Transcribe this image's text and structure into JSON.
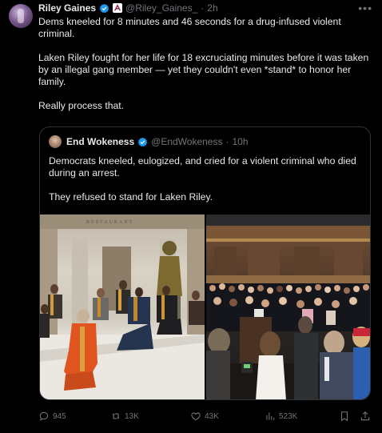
{
  "tweet": {
    "author_name": "Riley Gaines",
    "author_handle": "@Riley_Gaines_",
    "separator": "·",
    "time": "2h",
    "paragraphs": [
      "Dems kneeled for 8 minutes and 46 seconds for a drug-infused violent criminal.",
      "Laken Riley fought for her life for 18 excruciating minutes before it was taken by an illegal gang member — yet they couldn't even *stand* to honor her family.",
      "Really process that."
    ]
  },
  "quote": {
    "author_name": "End Wokeness",
    "author_handle": "@EndWokeness",
    "separator": "·",
    "time": "10h",
    "paragraphs": [
      "Democrats kneeled, eulogized, and cried for a violent criminal who died during an arrest.",
      "They refused to stand for Laken Riley."
    ],
    "photos": [
      {
        "name": "photo-kneeling-capitol",
        "banner_text": "RESTAURANT"
      },
      {
        "name": "photo-house-chamber"
      }
    ]
  },
  "actions": {
    "replies": "945",
    "reposts": "13K",
    "likes": "43K",
    "views": "523K"
  },
  "colors": {
    "background": "#000000",
    "text": "#e7e9ea",
    "muted": "#71767b",
    "border": "#2f3336",
    "verified_blue": "#1d9bf0"
  },
  "icons": [
    "verified-icon",
    "org-badge-icon",
    "more-icon",
    "reply-icon",
    "repost-icon",
    "like-icon",
    "views-icon",
    "bookmark-icon",
    "share-icon"
  ]
}
